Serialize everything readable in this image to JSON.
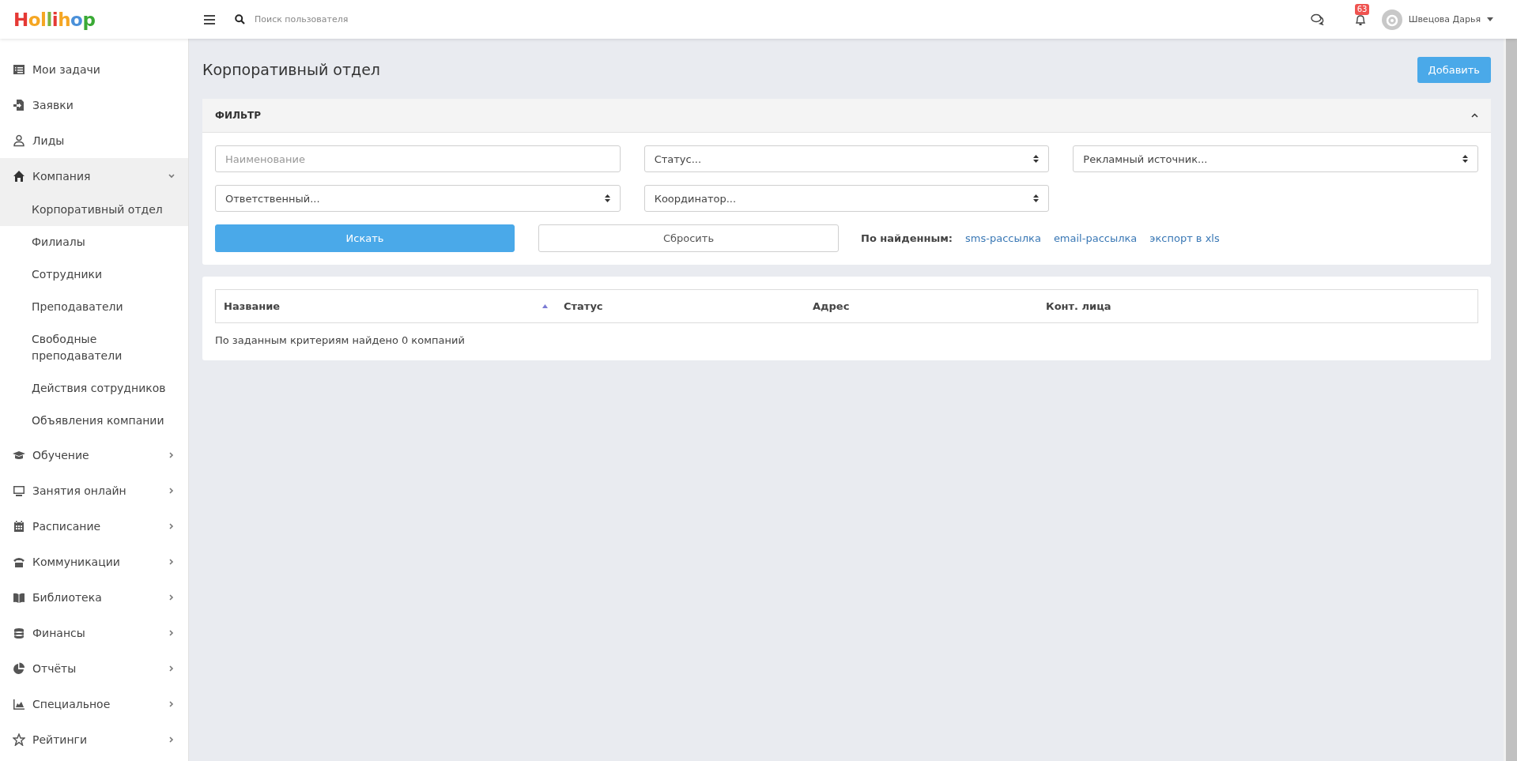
{
  "topbar": {
    "logo": "Hollihop",
    "search": {
      "placeholder": "Поиск пользователя"
    },
    "notifications": {
      "count": "63"
    },
    "user": {
      "name": "Швецова Дарья"
    }
  },
  "sidebar": {
    "items": [
      {
        "label": "Мои задачи"
      },
      {
        "label": "Заявки"
      },
      {
        "label": "Лиды"
      },
      {
        "label": "Компания",
        "expanded": true,
        "children": [
          {
            "label": "Корпоративный отдел",
            "selected": true
          },
          {
            "label": "Филиалы",
            "selected": false
          },
          {
            "label": "Сотрудники",
            "selected": false
          },
          {
            "label": "Преподаватели",
            "selected": false
          },
          {
            "label": "Свободные преподаватели",
            "selected": false
          },
          {
            "label": "Действия сотрудников",
            "selected": false
          },
          {
            "label": "Объявления компании",
            "selected": false
          }
        ]
      },
      {
        "label": "Обучение",
        "expanded": false
      },
      {
        "label": "Занятия онлайн",
        "expanded": false
      },
      {
        "label": "Расписание",
        "expanded": false
      },
      {
        "label": "Коммуникации",
        "expanded": false
      },
      {
        "label": "Библиотека",
        "expanded": false
      },
      {
        "label": "Финансы",
        "expanded": false
      },
      {
        "label": "Отчёты",
        "expanded": false
      },
      {
        "label": "Специальное",
        "expanded": false
      },
      {
        "label": "Рейтинги",
        "expanded": false
      }
    ]
  },
  "page": {
    "title": "Корпоративный отдел",
    "add_button": "Добавить"
  },
  "filter": {
    "title": "ФИЛЬТР",
    "expanded": true,
    "fields": [
      {
        "kind": "text",
        "placeholder": "Наименование"
      },
      {
        "kind": "select",
        "value": "Статус..."
      },
      {
        "kind": "select",
        "value": "Рекламный источник..."
      },
      {
        "kind": "select",
        "value": "Ответственный..."
      },
      {
        "kind": "select",
        "value": "Координатор..."
      }
    ],
    "search_button": "Искать",
    "reset_button": "Сбросить",
    "found_label": "По найденным:",
    "links": [
      "sms-рассылка",
      "email-рассылка",
      "экспорт в xls"
    ]
  },
  "table": {
    "columns": [
      {
        "label": "Название",
        "sorted": true
      },
      {
        "label": "Статус",
        "sorted": false
      },
      {
        "label": "Адрес",
        "sorted": false
      },
      {
        "label": "Конт. лица",
        "sorted": false
      }
    ],
    "empty_message": "По заданным критериям найдено 0 компаний"
  }
}
